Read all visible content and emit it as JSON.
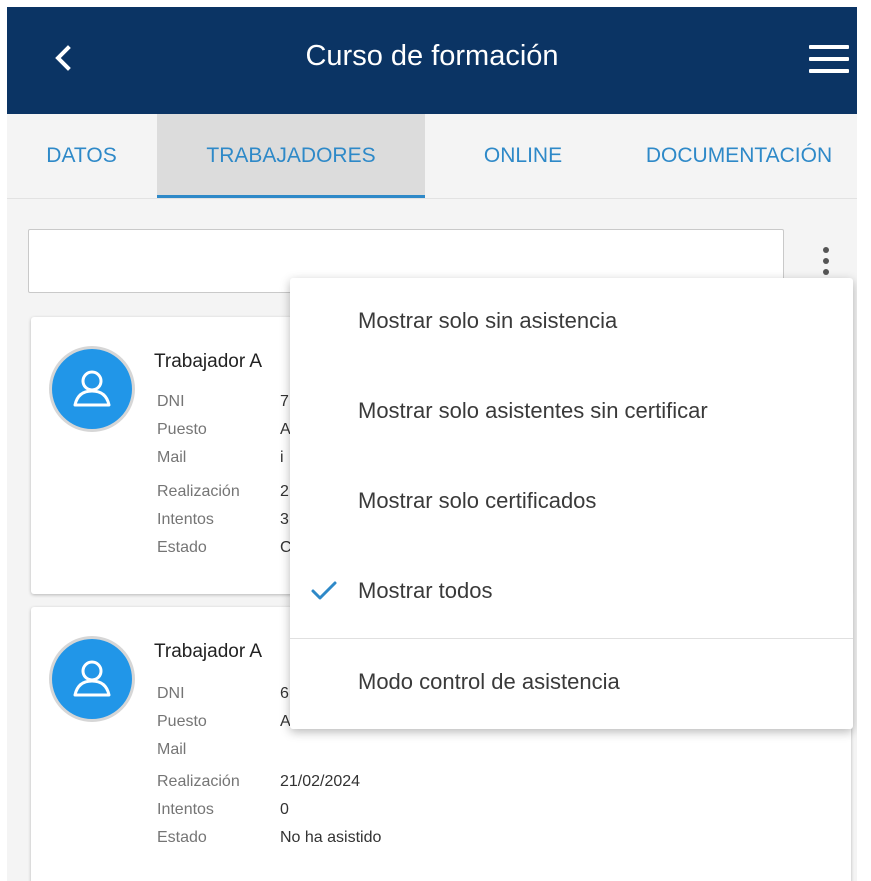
{
  "header": {
    "title": "Curso de formación"
  },
  "tabs": [
    {
      "label": "DATOS"
    },
    {
      "label": "TRABAJADORES"
    },
    {
      "label": "ONLINE"
    },
    {
      "label": "DOCUMENTACIÓN"
    }
  ],
  "search": {
    "value": ""
  },
  "cards": [
    {
      "name": "Trabajador A",
      "fields": [
        {
          "label": "DNI",
          "value": "7"
        },
        {
          "label": "Puesto",
          "value": "A"
        },
        {
          "label": "Mail",
          "value": "i"
        },
        {
          "label": "Realización",
          "value": "2"
        },
        {
          "label": "Intentos",
          "value": "3"
        },
        {
          "label": "Estado",
          "value": "C"
        }
      ]
    },
    {
      "name": "Trabajador A",
      "fields": [
        {
          "label": "DNI",
          "value": "6"
        },
        {
          "label": "Puesto",
          "value": "A"
        },
        {
          "label": "Mail",
          "value": ""
        },
        {
          "label": "Realización",
          "value": "21/02/2024"
        },
        {
          "label": "Intentos",
          "value": "0"
        },
        {
          "label": "Estado",
          "value": "No ha asistido"
        }
      ]
    }
  ],
  "menu": {
    "items": [
      {
        "label": "Mostrar solo sin asistencia"
      },
      {
        "label": "Mostrar solo asistentes sin certificar"
      },
      {
        "label": "Mostrar solo certificados"
      },
      {
        "label": "Mostrar todos"
      },
      {
        "label": "Modo control de asistencia"
      }
    ],
    "checked_index": 3
  },
  "colors": {
    "header": "#0b3464",
    "accent": "#2e89c8",
    "avatar": "#2196e8"
  },
  "icons": [
    "back-arrow-icon",
    "hamburger-menu-icon",
    "more-vert-icon",
    "user-icon",
    "check-icon"
  ]
}
